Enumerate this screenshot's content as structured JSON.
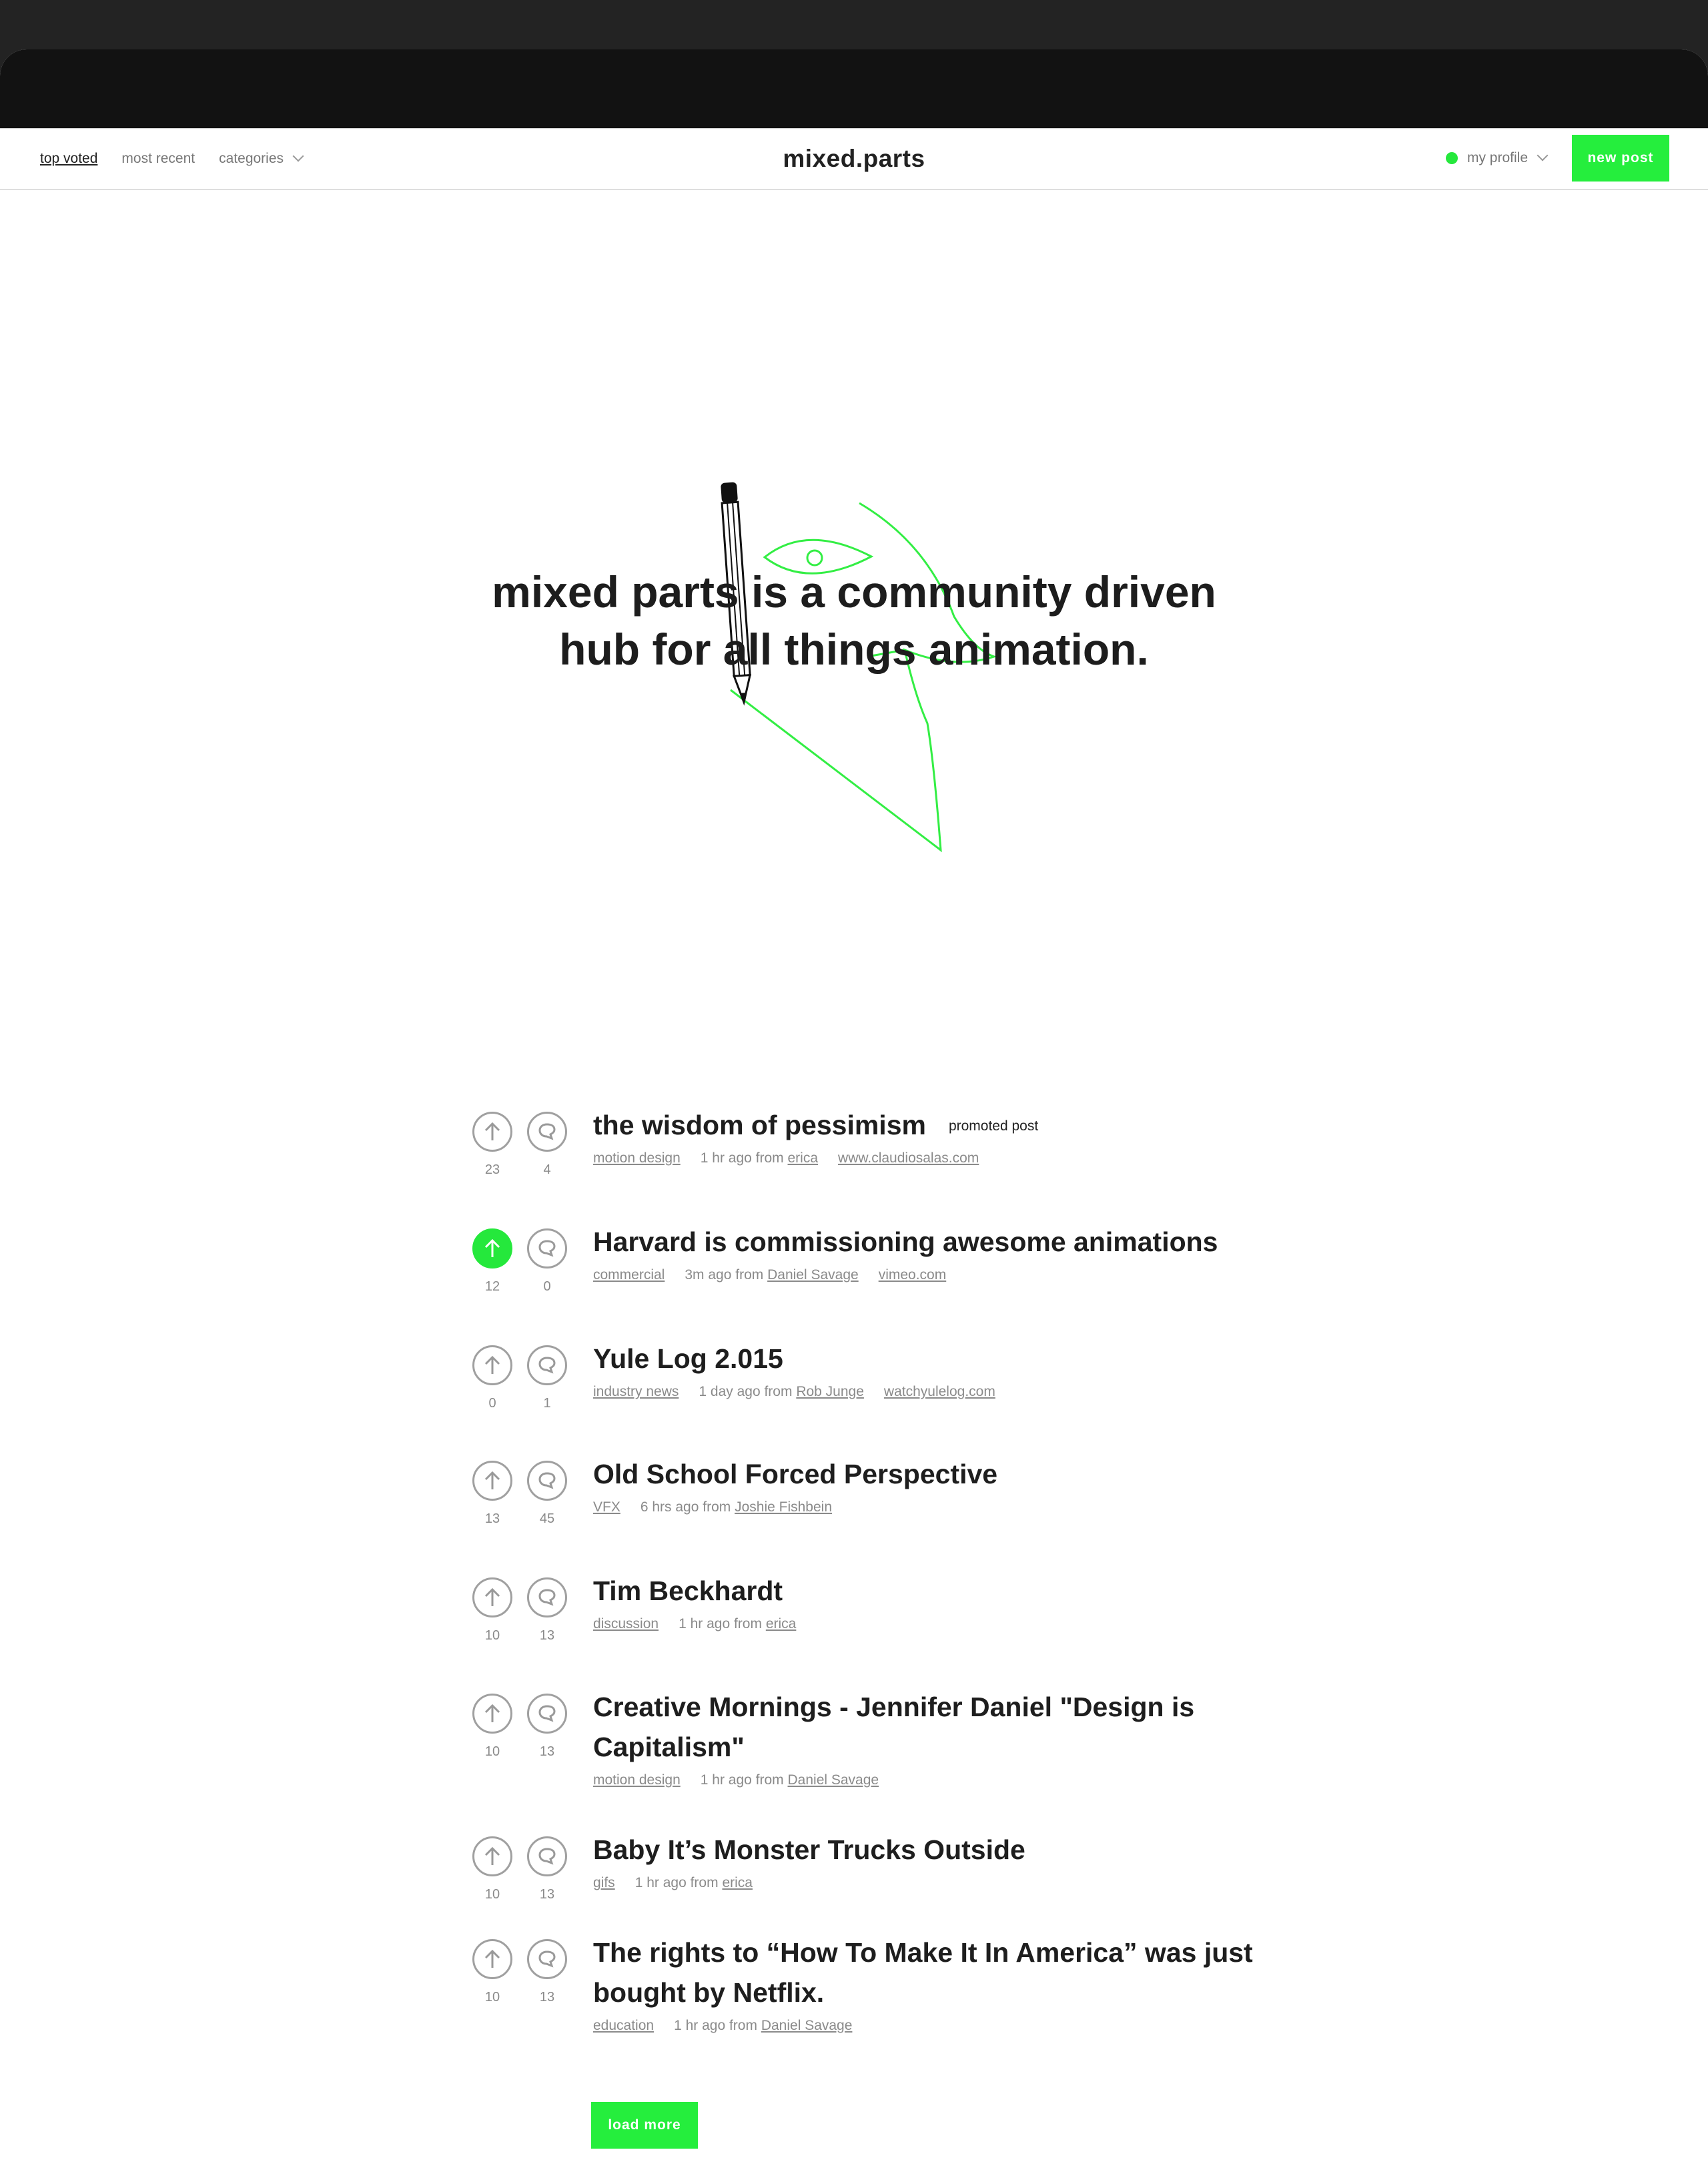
{
  "nav": {
    "top_voted": "top voted",
    "most_recent": "most recent",
    "categories": "categories",
    "brand": "mixed.parts",
    "my_profile": "my profile",
    "new_post": "new post"
  },
  "hero": {
    "line1": "mixed parts is a community driven",
    "line2": "hub for all things animation."
  },
  "posts": [
    {
      "title": "the wisdom of pessimism",
      "badge": "promoted post",
      "category": "motion design",
      "time": "1 hr ago from",
      "author": "erica",
      "link": "www.claudiosalas.com",
      "votes": "23",
      "comments": "4",
      "voted": false
    },
    {
      "title": "Harvard is commissioning awesome animations",
      "category": "commercial",
      "time": "3m ago from",
      "author": "Daniel Savage",
      "link": "vimeo.com",
      "votes": "12",
      "comments": "0",
      "voted": true
    },
    {
      "title": "Yule Log 2.015",
      "category": "industry news",
      "time": "1 day ago from",
      "author": "Rob Junge",
      "link": "watchyulelog.com",
      "votes": "0",
      "comments": "1",
      "voted": false
    },
    {
      "title": "Old School Forced Perspective",
      "category": "VFX",
      "time": "6 hrs ago from",
      "author": "Joshie Fishbein",
      "votes": "13",
      "comments": "45",
      "voted": false
    },
    {
      "title": "Tim Beckhardt",
      "category": "discussion",
      "time": "1 hr ago from",
      "author": "erica",
      "votes": "10",
      "comments": "13",
      "voted": false
    },
    {
      "title": "Creative Mornings - Jennifer Daniel \"Design is Capitalism\"",
      "category": "motion design",
      "time": "1 hr ago from",
      "author": "Daniel Savage",
      "votes": "10",
      "comments": "13",
      "voted": false
    },
    {
      "title": "Baby It’s Monster Trucks Outside",
      "category": "gifs",
      "time": "1 hr ago from",
      "author": "erica",
      "votes": "10",
      "comments": "13",
      "voted": false
    },
    {
      "title": "The rights to “How To Make It In America” was just bought by Netflix.",
      "category": "education",
      "time": "1 hr ago from",
      "author": "Daniel Savage",
      "votes": "10",
      "comments": "13",
      "voted": false
    }
  ],
  "load_more": "load more",
  "colors": {
    "accent": "#25ee3d",
    "text": "#1e1e1e",
    "muted": "#8a8a8a"
  }
}
